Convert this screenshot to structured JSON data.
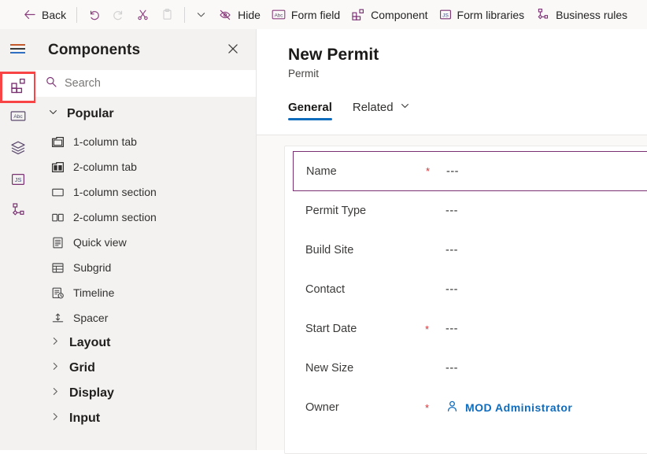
{
  "commandbar": {
    "items": [
      {
        "id": "back",
        "label": "Back",
        "icon": "arrow-left-icon",
        "enabled": true
      },
      {
        "id": "undo",
        "label": "",
        "icon": "undo-icon",
        "enabled": true
      },
      {
        "id": "redo",
        "label": "",
        "icon": "redo-icon",
        "enabled": false
      },
      {
        "id": "cut",
        "label": "",
        "icon": "scissors-icon",
        "enabled": true
      },
      {
        "id": "paste",
        "label": "",
        "icon": "clipboard-icon",
        "enabled": false
      },
      {
        "id": "more",
        "label": "",
        "icon": "chevron-down-icon",
        "enabled": true
      },
      {
        "id": "hide",
        "label": "Hide",
        "icon": "eye-slash-icon",
        "enabled": true
      },
      {
        "id": "form-field",
        "label": "Form field",
        "icon": "abc-box-icon",
        "enabled": true
      },
      {
        "id": "component",
        "label": "Component",
        "icon": "component-grid-icon",
        "enabled": true
      },
      {
        "id": "form-libraries",
        "label": "Form libraries",
        "icon": "js-box-icon",
        "enabled": true
      },
      {
        "id": "business-rules",
        "label": "Business rules",
        "icon": "business-rules-icon",
        "enabled": true
      }
    ]
  },
  "rail": {
    "items": [
      {
        "id": "menu",
        "icon": "hamburger-menu-icon",
        "highlighted": false
      },
      {
        "id": "components",
        "icon": "component-grid-icon",
        "highlighted": true
      },
      {
        "id": "table-columns",
        "icon": "abc-box-icon",
        "highlighted": false
      },
      {
        "id": "layers",
        "icon": "layers-icon",
        "highlighted": false
      },
      {
        "id": "form-libraries",
        "icon": "js-box-icon",
        "highlighted": false
      },
      {
        "id": "business-rules",
        "icon": "business-rules-icon",
        "highlighted": false
      }
    ],
    "highlight_color": "#f84444"
  },
  "panel": {
    "title": "Components",
    "close_icon": "close-icon",
    "search": {
      "placeholder": "Search",
      "value": "",
      "icon": "search-icon"
    },
    "group": {
      "label": "Popular",
      "expanded": true,
      "icon": "chevron-down-icon"
    },
    "components": [
      {
        "label": "1-column tab",
        "icon": "one-column-tab-icon"
      },
      {
        "label": "2-column tab",
        "icon": "two-column-tab-icon"
      },
      {
        "label": "1-column section",
        "icon": "one-column-section-icon"
      },
      {
        "label": "2-column section",
        "icon": "two-column-section-icon"
      },
      {
        "label": "Quick view",
        "icon": "quick-view-icon"
      },
      {
        "label": "Subgrid",
        "icon": "subgrid-icon"
      },
      {
        "label": "Timeline",
        "icon": "timeline-icon"
      },
      {
        "label": "Spacer",
        "icon": "spacer-icon"
      }
    ],
    "categories": [
      {
        "label": "Layout",
        "expanded": false,
        "icon": "chevron-right-icon"
      },
      {
        "label": "Grid",
        "expanded": false,
        "icon": "chevron-right-icon"
      },
      {
        "label": "Display",
        "expanded": false,
        "icon": "chevron-right-icon"
      },
      {
        "label": "Input",
        "expanded": false,
        "icon": "chevron-right-icon"
      }
    ]
  },
  "form": {
    "title": "New Permit",
    "subtitle": "Permit",
    "tabs": [
      {
        "label": "General",
        "active": true,
        "has_chevron": false
      },
      {
        "label": "Related",
        "active": false,
        "has_chevron": true
      }
    ],
    "selection_color": "#7a2f72",
    "accent_color": "#0f6cbd",
    "required_color": "#d13438",
    "fields": [
      {
        "label": "Name",
        "required": true,
        "value": "---",
        "selected": true,
        "is_link": false
      },
      {
        "label": "Permit Type",
        "required": false,
        "value": "---",
        "selected": false,
        "is_link": false
      },
      {
        "label": "Build Site",
        "required": false,
        "value": "---",
        "selected": false,
        "is_link": false
      },
      {
        "label": "Contact",
        "required": false,
        "value": "---",
        "selected": false,
        "is_link": false
      },
      {
        "label": "Start Date",
        "required": true,
        "value": "---",
        "selected": false,
        "is_link": false
      },
      {
        "label": "New Size",
        "required": false,
        "value": "---",
        "selected": false,
        "is_link": false
      },
      {
        "label": "Owner",
        "required": true,
        "value": "MOD Administrator",
        "selected": false,
        "is_link": true,
        "icon": "person-icon"
      }
    ]
  }
}
